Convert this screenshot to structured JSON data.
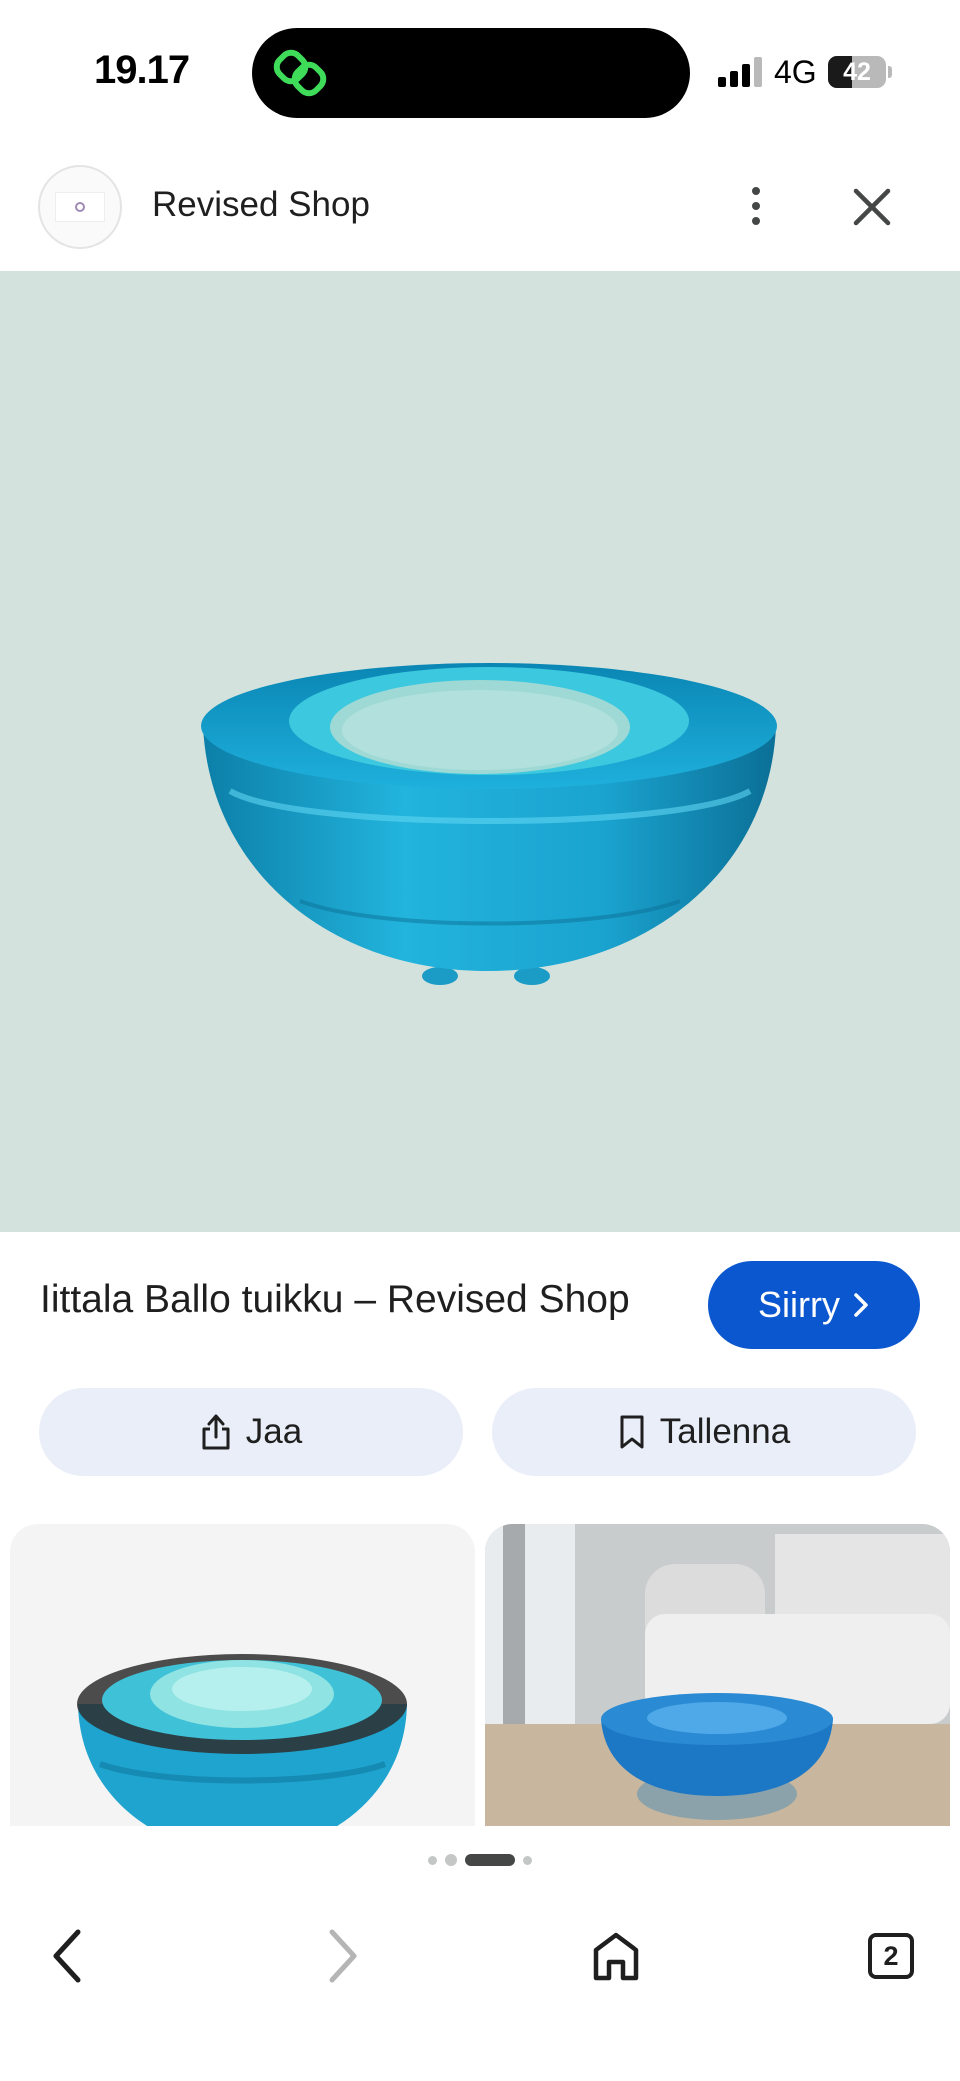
{
  "status_bar": {
    "time": "19.17",
    "network": "4G",
    "battery": "42",
    "battery_level": 0.42
  },
  "header": {
    "site_name": "Revised Shop",
    "icons": {
      "more": "more-vert-icon",
      "close": "close-icon"
    }
  },
  "result": {
    "title": "Iittala Ballo tuikku – Revised Shop",
    "visit_label": "Siirry",
    "share_label": "Jaa",
    "save_label": "Tallenna"
  },
  "pager": {
    "total_dots": 4,
    "active_index": 2
  },
  "toolbar": {
    "tabs_count": "2",
    "icons": [
      "back-icon",
      "forward-icon",
      "home-icon",
      "tabs-icon"
    ]
  },
  "colors": {
    "accent": "#0b57d0",
    "chip_bg": "#e9eef8",
    "image_bg": "#d3e2dd",
    "glass": "#1ea4cf"
  }
}
